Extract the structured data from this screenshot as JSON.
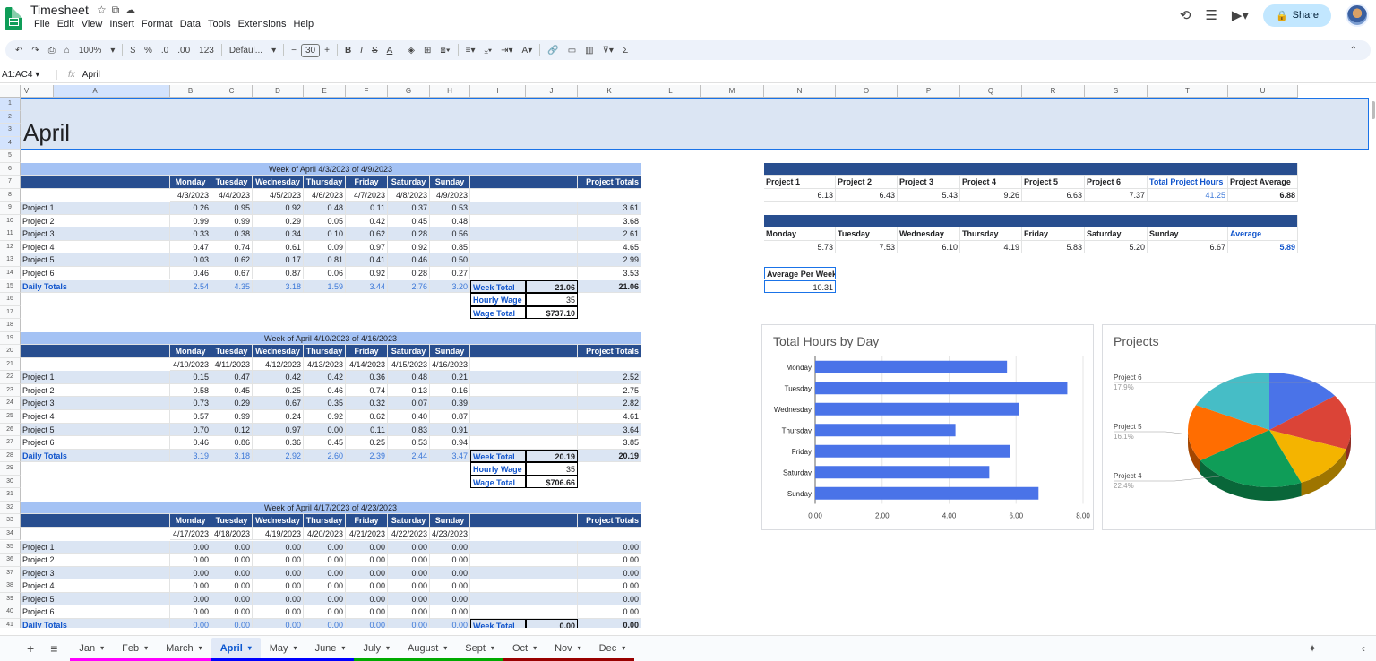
{
  "app": {
    "title": "Timesheet",
    "menu": [
      "File",
      "Edit",
      "View",
      "Insert",
      "Format",
      "Data",
      "Tools",
      "Extensions",
      "Help"
    ],
    "share_label": "Share"
  },
  "toolbar": {
    "zoom": "100%",
    "currency": "$",
    "percent": "%",
    "dec_less": ".0",
    "dec_more": ".00",
    "number_format": "123",
    "font": "Defaul...",
    "font_size": "30"
  },
  "formula_bar": {
    "name_box": "A1:AC4",
    "formula": "April"
  },
  "columns": [
    "A",
    "B",
    "C",
    "D",
    "E",
    "F",
    "G",
    "H",
    "I",
    "J",
    "K",
    "L",
    "M",
    "N",
    "O",
    "P",
    "Q",
    "R",
    "S",
    "T",
    "U",
    "V"
  ],
  "sheet_title": "April",
  "days": [
    "Monday",
    "Tuesday",
    "Wednesday",
    "Thursday",
    "Friday",
    "Saturday",
    "Sunday"
  ],
  "labels": {
    "project_totals": "Project Totals",
    "daily_totals": "Daily Totals",
    "week_total": "Week Total",
    "hourly_wage": "Hourly Wage",
    "wage_total": "Wage Total",
    "total_project_hours": "Total Project Hours",
    "project_average": "Project Average",
    "average": "Average",
    "average_per_week": "Average Per Week"
  },
  "weeks": [
    {
      "header": "Week of April 4/3/2023 of 4/9/2023",
      "dates": [
        "4/3/2023",
        "4/4/2023",
        "4/5/2023",
        "4/6/2023",
        "4/7/2023",
        "4/8/2023",
        "4/9/2023"
      ],
      "projects": [
        [
          "Project 1",
          "0.26",
          "0.95",
          "0.92",
          "0.48",
          "0.11",
          "0.37",
          "0.53",
          "3.61"
        ],
        [
          "Project 2",
          "0.99",
          "0.99",
          "0.29",
          "0.05",
          "0.42",
          "0.45",
          "0.48",
          "3.68"
        ],
        [
          "Project 3",
          "0.33",
          "0.38",
          "0.34",
          "0.10",
          "0.62",
          "0.28",
          "0.56",
          "2.61"
        ],
        [
          "Project 4",
          "0.47",
          "0.74",
          "0.61",
          "0.09",
          "0.97",
          "0.92",
          "0.85",
          "4.65"
        ],
        [
          "Project 5",
          "0.03",
          "0.62",
          "0.17",
          "0.81",
          "0.41",
          "0.46",
          "0.50",
          "2.99"
        ],
        [
          "Project 6",
          "0.46",
          "0.67",
          "0.87",
          "0.06",
          "0.92",
          "0.28",
          "0.27",
          "3.53"
        ]
      ],
      "daily": [
        "2.54",
        "4.35",
        "3.18",
        "1.59",
        "3.44",
        "2.76",
        "3.20",
        "21.06"
      ],
      "week_total": "21.06",
      "hourly_wage": "35",
      "wage_total": "$737.10"
    },
    {
      "header": "Week of April 4/10/2023 of 4/16/2023",
      "dates": [
        "4/10/2023",
        "4/11/2023",
        "4/12/2023",
        "4/13/2023",
        "4/14/2023",
        "4/15/2023",
        "4/16/2023"
      ],
      "projects": [
        [
          "Project 1",
          "0.15",
          "0.47",
          "0.42",
          "0.42",
          "0.36",
          "0.48",
          "0.21",
          "2.52"
        ],
        [
          "Project 2",
          "0.58",
          "0.45",
          "0.25",
          "0.46",
          "0.74",
          "0.13",
          "0.16",
          "2.75"
        ],
        [
          "Project 3",
          "0.73",
          "0.29",
          "0.67",
          "0.35",
          "0.32",
          "0.07",
          "0.39",
          "2.82"
        ],
        [
          "Project 4",
          "0.57",
          "0.99",
          "0.24",
          "0.92",
          "0.62",
          "0.40",
          "0.87",
          "4.61"
        ],
        [
          "Project 5",
          "0.70",
          "0.12",
          "0.97",
          "0.00",
          "0.11",
          "0.83",
          "0.91",
          "3.64"
        ],
        [
          "Project 6",
          "0.46",
          "0.86",
          "0.36",
          "0.45",
          "0.25",
          "0.53",
          "0.94",
          "3.85"
        ]
      ],
      "daily": [
        "3.19",
        "3.18",
        "2.92",
        "2.60",
        "2.39",
        "2.44",
        "3.47",
        "20.19"
      ],
      "week_total": "20.19",
      "hourly_wage": "35",
      "wage_total": "$706.66"
    },
    {
      "header": "Week of April 4/17/2023 of 4/23/2023",
      "dates": [
        "4/17/2023",
        "4/18/2023",
        "4/19/2023",
        "4/20/2023",
        "4/21/2023",
        "4/22/2023",
        "4/23/2023"
      ],
      "projects": [
        [
          "Project 1",
          "0.00",
          "0.00",
          "0.00",
          "0.00",
          "0.00",
          "0.00",
          "0.00",
          "0.00"
        ],
        [
          "Project 2",
          "0.00",
          "0.00",
          "0.00",
          "0.00",
          "0.00",
          "0.00",
          "0.00",
          "0.00"
        ],
        [
          "Project 3",
          "0.00",
          "0.00",
          "0.00",
          "0.00",
          "0.00",
          "0.00",
          "0.00",
          "0.00"
        ],
        [
          "Project 4",
          "0.00",
          "0.00",
          "0.00",
          "0.00",
          "0.00",
          "0.00",
          "0.00",
          "0.00"
        ],
        [
          "Project 5",
          "0.00",
          "0.00",
          "0.00",
          "0.00",
          "0.00",
          "0.00",
          "0.00",
          "0.00"
        ],
        [
          "Project 6",
          "0.00",
          "0.00",
          "0.00",
          "0.00",
          "0.00",
          "0.00",
          "0.00",
          "0.00"
        ]
      ],
      "daily": [
        "0.00",
        "0.00",
        "0.00",
        "0.00",
        "0.00",
        "0.00",
        "0.00",
        "0.00"
      ],
      "week_total": "0.00"
    }
  ],
  "summary": {
    "project_headers": [
      "Project 1",
      "Project 2",
      "Project 3",
      "Project 4",
      "Project 5",
      "Project 6"
    ],
    "project_values": [
      "6.13",
      "6.43",
      "5.43",
      "9.26",
      "6.63",
      "7.37"
    ],
    "total_project_hours": "41.25",
    "project_average": "6.88",
    "day_values": [
      "5.73",
      "7.53",
      "6.10",
      "4.19",
      "5.83",
      "5.20",
      "6.67"
    ],
    "day_average": "5.89",
    "average_per_week": "10.31"
  },
  "chart_data": [
    {
      "type": "bar",
      "title": "Total Hours by Day",
      "categories": [
        "Monday",
        "Tuesday",
        "Wednesday",
        "Thursday",
        "Friday",
        "Saturday",
        "Sunday"
      ],
      "values": [
        5.73,
        7.53,
        6.1,
        4.19,
        5.83,
        5.2,
        6.67
      ],
      "xlim": [
        0,
        8
      ],
      "ticks": [
        "0.00",
        "2.00",
        "4.00",
        "6.00",
        "8.00"
      ],
      "color": "#4a73e8",
      "orientation": "horizontal"
    },
    {
      "type": "pie",
      "title": "Projects",
      "labels": [
        {
          "name": "Project 6",
          "pct": "17.9%"
        },
        {
          "name": "Project 5",
          "pct": "16.1%"
        },
        {
          "name": "Project 4",
          "pct": "22.4%"
        }
      ],
      "slices": [
        {
          "name": "Project 1",
          "value": 6.13,
          "color": "#4a73e8"
        },
        {
          "name": "Project 2",
          "value": 6.43,
          "color": "#db4437"
        },
        {
          "name": "Project 3",
          "value": 5.43,
          "color": "#f4b400"
        },
        {
          "name": "Project 4",
          "value": 9.26,
          "color": "#0f9d58"
        },
        {
          "name": "Project 5",
          "value": 6.63,
          "color": "#ff6d01"
        },
        {
          "name": "Project 6",
          "value": 7.37,
          "color": "#46bdc6"
        }
      ],
      "style": "3d"
    }
  ],
  "tabs": [
    {
      "name": "Jan",
      "color": "#ff00ff"
    },
    {
      "name": "Feb",
      "color": "#ff00ff"
    },
    {
      "name": "March",
      "color": "#ff00ff"
    },
    {
      "name": "April",
      "color": "#0000ff"
    },
    {
      "name": "May",
      "color": "#0000ff"
    },
    {
      "name": "June",
      "color": "#0000ff"
    },
    {
      "name": "July",
      "color": "#00aa00"
    },
    {
      "name": "August",
      "color": "#00aa00"
    },
    {
      "name": "Sept",
      "color": "#00aa00"
    },
    {
      "name": "Oct",
      "color": "#990000"
    },
    {
      "name": "Nov",
      "color": "#990000"
    },
    {
      "name": "Dec",
      "color": "#990000"
    }
  ],
  "active_tab": "April"
}
